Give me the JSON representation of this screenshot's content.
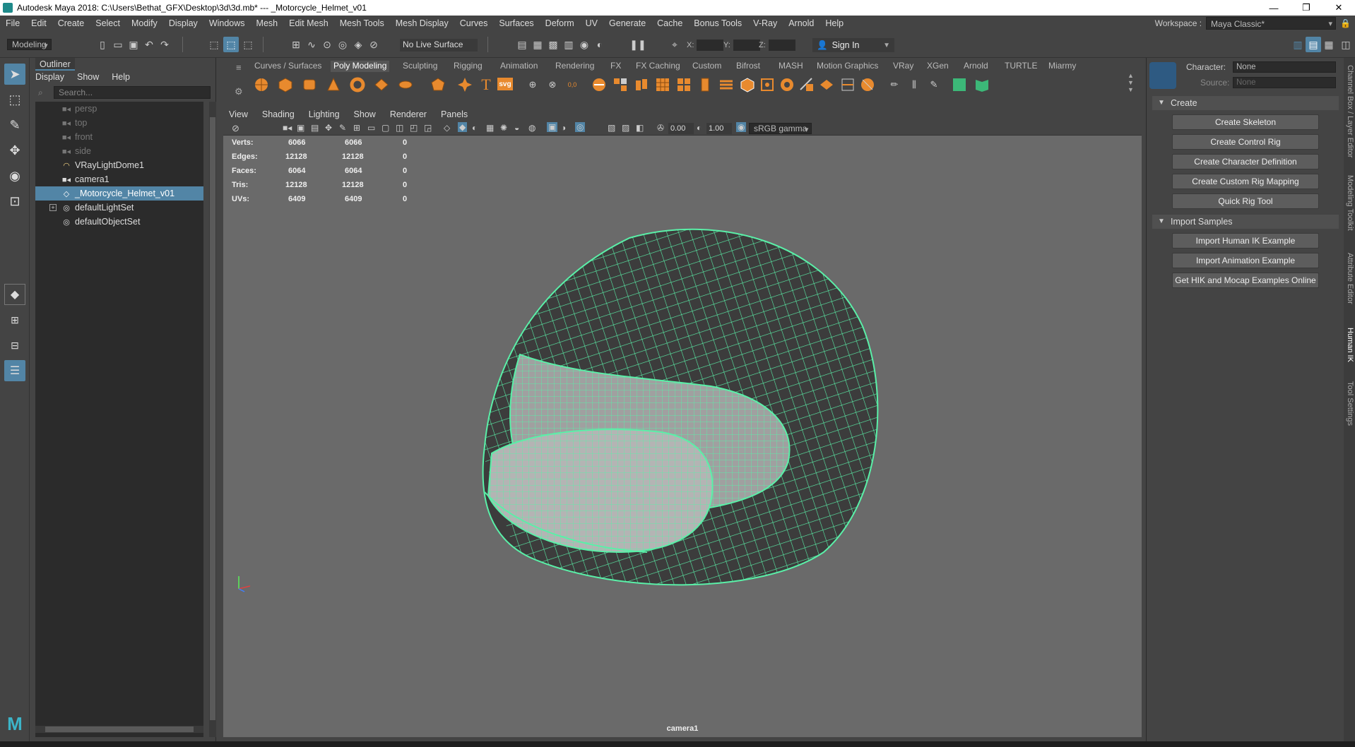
{
  "window": {
    "title": "Autodesk Maya 2018: C:\\Users\\Bethat_GFX\\Desktop\\3d\\3d.mb*   ---   _Motorcycle_Helmet_v01",
    "minimize": "—",
    "restore": "❐",
    "close": "✕"
  },
  "menubar": {
    "items": [
      "File",
      "Edit",
      "Create",
      "Select",
      "Modify",
      "Display",
      "Windows",
      "Mesh",
      "Edit Mesh",
      "Mesh Tools",
      "Mesh Display",
      "Curves",
      "Surfaces",
      "Deform",
      "UV",
      "Generate",
      "Cache",
      "Bonus Tools",
      "V-Ray",
      "Arnold",
      "Help"
    ],
    "workspace_label": "Workspace :",
    "workspace_value": "Maya Classic*"
  },
  "statusline": {
    "mode": "Modeling",
    "live_surface": "No Live Surface",
    "x_label": "X:",
    "y_label": "Y:",
    "z_label": "Z:",
    "sign_in": "Sign In"
  },
  "outliner": {
    "tab": "Outliner",
    "menu": [
      "Display",
      "Show",
      "Help"
    ],
    "search_placeholder": "Search...",
    "items": [
      {
        "label": "persp",
        "icon": "camera-icon",
        "dim": true
      },
      {
        "label": "top",
        "icon": "camera-icon",
        "dim": true
      },
      {
        "label": "front",
        "icon": "camera-icon",
        "dim": true
      },
      {
        "label": "side",
        "icon": "camera-icon",
        "dim": true
      },
      {
        "label": "VRayLightDome1",
        "icon": "dome-light-icon",
        "dim": false
      },
      {
        "label": "camera1",
        "icon": "camera-icon",
        "dim": false
      },
      {
        "label": "_Motorcycle_Helmet_v01",
        "icon": "mesh-icon",
        "dim": false,
        "selected": true
      },
      {
        "label": "defaultLightSet",
        "icon": "set-icon",
        "dim": false,
        "expand": "+"
      },
      {
        "label": "defaultObjectSet",
        "icon": "set-icon",
        "dim": false
      }
    ]
  },
  "shelf": {
    "tabs": [
      "Curves / Surfaces",
      "Poly Modeling",
      "Sculpting",
      "Rigging",
      "Animation",
      "Rendering",
      "FX",
      "FX Caching",
      "Custom",
      "Bifrost",
      "MASH",
      "Motion Graphics",
      "VRay",
      "XGen",
      "Arnold",
      "TURTLE",
      "Miarmy"
    ],
    "active_tab": "Poly Modeling",
    "text_icon": "T",
    "svg_icon": "svg",
    "coord_icon": "0,0"
  },
  "viewport": {
    "menu": [
      "View",
      "Shading",
      "Lighting",
      "Show",
      "Renderer",
      "Panels"
    ],
    "exposure": "0.00",
    "gamma": "1.00",
    "color_space": "sRGB gamma",
    "camera_label": "camera1",
    "stats": [
      {
        "label": "Verts:",
        "a": "6066",
        "b": "6066",
        "c": "0"
      },
      {
        "label": "Edges:",
        "a": "12128",
        "b": "12128",
        "c": "0"
      },
      {
        "label": "Faces:",
        "a": "6064",
        "b": "6064",
        "c": "0"
      },
      {
        "label": "Tris:",
        "a": "12128",
        "b": "12128",
        "c": "0"
      },
      {
        "label": "UVs:",
        "a": "6409",
        "b": "6409",
        "c": "0"
      }
    ]
  },
  "human_ik": {
    "character_label": "Character:",
    "character_value": "None",
    "source_label": "Source:",
    "source_value": "None",
    "create_section": "Create",
    "create_buttons": [
      "Create Skeleton",
      "Create Control Rig",
      "Create Character Definition",
      "Create Custom Rig Mapping",
      "Quick Rig Tool"
    ],
    "import_section": "Import Samples",
    "import_buttons": [
      "Import Human IK Example",
      "Import Animation Example",
      "Get HIK and Mocap Examples Online"
    ]
  },
  "side_tabs": [
    "Channel Box / Layer Editor",
    "Modeling Toolkit",
    "Attribute Editor",
    "Human IK",
    "Tool Settings"
  ],
  "colors": {
    "accent": "#5285a6",
    "wireframe": "#5af0a8",
    "shelf_icon": "#e88a2e",
    "viewport_bg": "#6a6a6a"
  }
}
